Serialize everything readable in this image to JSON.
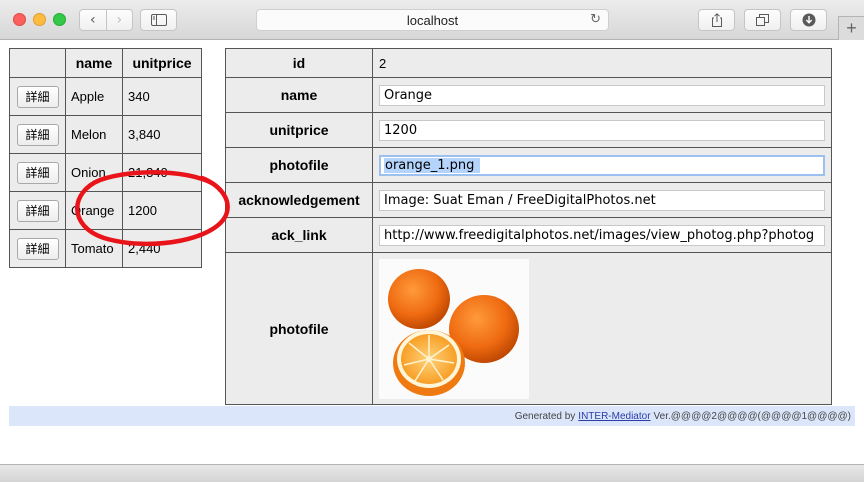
{
  "browser": {
    "url": "localhost",
    "nav_back": "‹",
    "nav_forward": "›",
    "plus": "+"
  },
  "list": {
    "headers": [
      "",
      "name",
      "unitprice"
    ],
    "button_label": "詳細",
    "rows": [
      {
        "name": "Apple",
        "unitprice": "340"
      },
      {
        "name": "Melon",
        "unitprice": "3,840"
      },
      {
        "name": "Onion",
        "unitprice": "21,340"
      },
      {
        "name": "Orange",
        "unitprice": "1200"
      },
      {
        "name": "Tomato",
        "unitprice": "2,440"
      }
    ]
  },
  "detail": {
    "fields": [
      {
        "label": "id",
        "value": "2"
      },
      {
        "label": "name",
        "value": "Orange"
      },
      {
        "label": "unitprice",
        "value": "1200"
      },
      {
        "label": "photofile",
        "value": "orange_1.png"
      },
      {
        "label": "acknowledgement",
        "value": "Image: Suat Eman / FreeDigitalPhotos.net"
      },
      {
        "label": "ack_link",
        "value": "http://www.freedigitalphotos.net/images/view_photog.php?photog"
      },
      {
        "label": "photofile",
        "value": ""
      }
    ]
  },
  "footer": {
    "prefix": "Generated by",
    "link": "INTER-Mediator",
    "suffix": "Ver.@@@@2@@@@(@@@@1@@@@)"
  },
  "colors": {
    "annotation": "#e8141a",
    "footer_bg": "#dbe6fa",
    "cell_bg": "#ececec"
  },
  "icons": [
    "sidebar-icon",
    "reload-icon",
    "share-icon",
    "tabs-icon",
    "download-icon"
  ]
}
